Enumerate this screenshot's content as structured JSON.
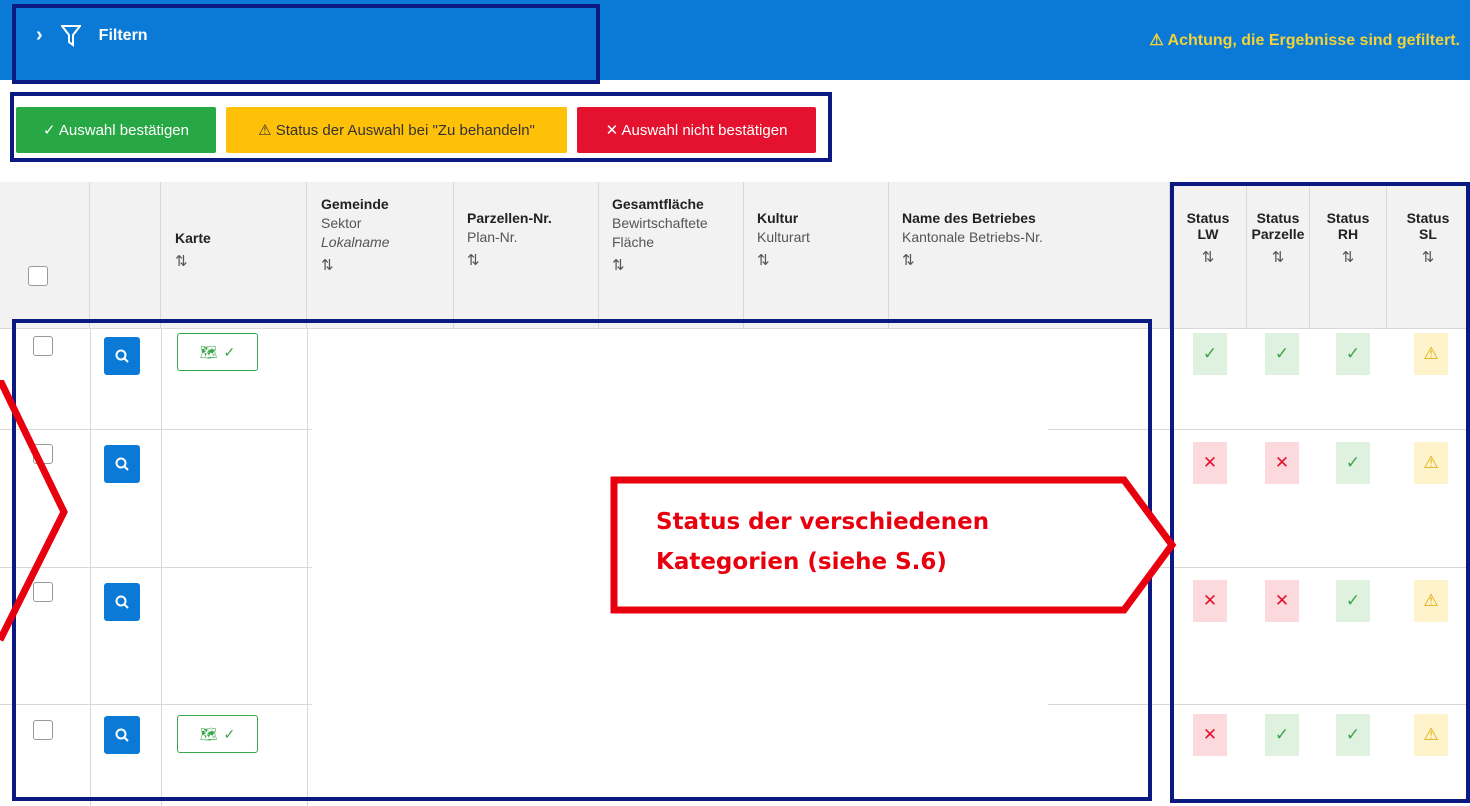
{
  "filter_bar": {
    "label": "Filtern",
    "warning": "⚠ Achtung, die Ergebnisse sind gefiltert.",
    "color": "#0a7ad6"
  },
  "actions": {
    "confirm_label": "✓ Auswahl bestätigen",
    "todo_label": "⚠ Status der Auswahl bei \"Zu behandeln\"",
    "reject_label": "✕ Auswahl nicht bestätigen"
  },
  "table": {
    "columns": [
      {
        "main": "Karte",
        "sub1": "",
        "sub2": ""
      },
      {
        "main": "Gemeinde",
        "sub1": "Sektor",
        "sub2": "Lokalname"
      },
      {
        "main": "Parzellen-Nr.",
        "sub1": "Plan-Nr.",
        "sub2": ""
      },
      {
        "main": "Gesamtfläche",
        "sub1": "Bewirtschaftete",
        "sub2": "Fläche"
      },
      {
        "main": "Kultur",
        "sub1": "Kulturart",
        "sub2": ""
      },
      {
        "main": "Name des Betriebes",
        "sub1": "Kantonale Betriebs-Nr.",
        "sub2": ""
      }
    ],
    "status_columns": [
      {
        "line1": "Status",
        "line2": "LW"
      },
      {
        "line1": "Status",
        "line2": "Parzelle"
      },
      {
        "line1": "Status",
        "line2": "RH"
      },
      {
        "line1": "Status",
        "line2": "SL"
      }
    ],
    "sort_icon": "⇅",
    "rows": [
      {
        "has_map": true,
        "statuses": [
          "ok",
          "ok",
          "ok",
          "warn"
        ]
      },
      {
        "has_map": false,
        "statuses": [
          "bad",
          "bad",
          "ok",
          "warn"
        ]
      },
      {
        "has_map": false,
        "statuses": [
          "bad",
          "bad",
          "ok",
          "warn"
        ]
      },
      {
        "has_map": true,
        "statuses": [
          "bad",
          "ok",
          "ok",
          "warn"
        ]
      }
    ]
  },
  "annotation": {
    "line1": "Status der verschiedenen",
    "line2": "Kategorien (siehe S.6)",
    "color": "#e8000e"
  }
}
